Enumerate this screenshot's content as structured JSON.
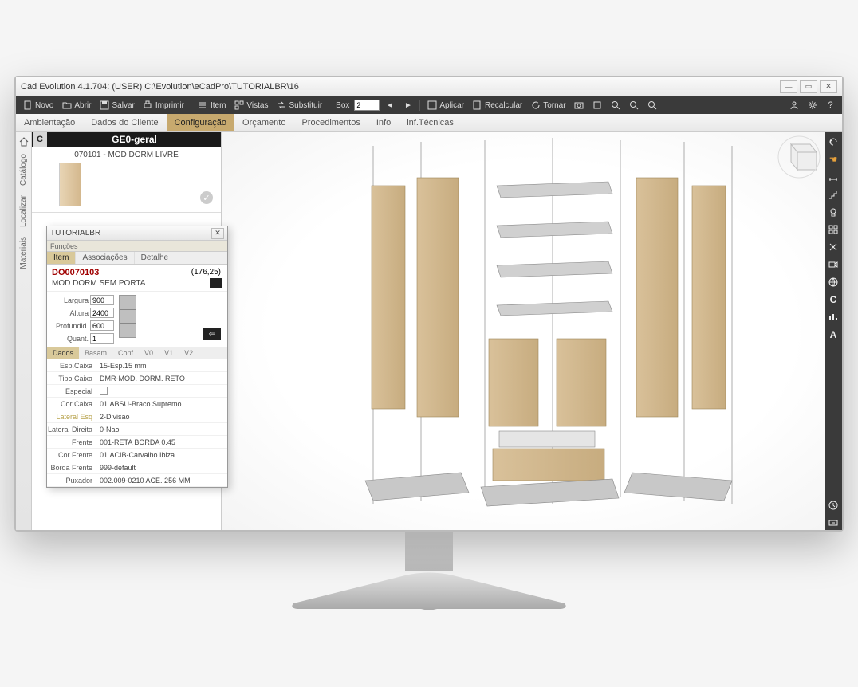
{
  "title": "Cad Evolution 4.1.704: (USER)  C:\\Evolution\\eCadPro\\TUTORIALBR\\16",
  "toolbar": {
    "novo": "Novo",
    "abrir": "Abrir",
    "salvar": "Salvar",
    "imprimir": "Imprimir",
    "item": "Item",
    "vistas": "Vistas",
    "substituir": "Substituir",
    "box_label": "Box",
    "box_value": "2",
    "aplicar": "Aplicar",
    "recalcular": "Recalcular",
    "tornar": "Tornar"
  },
  "menu": {
    "items": [
      "Ambientação",
      "Dados do Cliente",
      "Configuração",
      "Orçamento",
      "Procedimentos",
      "Info",
      "inf.Técnicas"
    ],
    "active_index": 2
  },
  "side_tabs": [
    "Catálogo",
    "Localizar",
    "Materiais"
  ],
  "nav": {
    "badge": "C",
    "title": "GE0-geral",
    "item_label": "070101 - MOD DORM LIVRE"
  },
  "dialog": {
    "title": "TUTORIALBR",
    "section": "Funções",
    "tabs": [
      "Item",
      "Associações",
      "Detalhe"
    ],
    "code": "DO0070103",
    "dim_display": "(176,25)",
    "name": "MOD DORM SEM PORTA",
    "dims": {
      "largura_label": "Largura",
      "largura": "900",
      "altura_label": "Altura",
      "altura": "2400",
      "profund_label": "Profundid.",
      "profund": "600",
      "quant_label": "Quant.",
      "quant": "1"
    },
    "dados_tabs": [
      "Dados",
      "Basam",
      "Conf",
      "V0",
      "V1",
      "V2"
    ],
    "rows": [
      {
        "k": "Esp.Caixa",
        "v": "15-Esp.15 mm"
      },
      {
        "k": "Tipo Caixa",
        "v": "DMR-MOD. DORM. RETO"
      },
      {
        "k": "Especial",
        "v": "",
        "checkbox": true
      },
      {
        "k": "Cor Caixa",
        "v": "01.ABSU-Braco Supremo"
      },
      {
        "k": "Lateral Esq",
        "v": "2-Divisao",
        "hl": true
      },
      {
        "k": "Lateral Direita",
        "v": "0-Nao"
      },
      {
        "k": "Frente",
        "v": "001-RETA BORDA 0.45"
      },
      {
        "k": "Cor Frente",
        "v": "01.ACIB-Carvalho Ibiza"
      },
      {
        "k": "Borda Frente",
        "v": "999-default"
      },
      {
        "k": "Puxador",
        "v": "002.009-0210 ACE. 256 MM"
      }
    ]
  }
}
